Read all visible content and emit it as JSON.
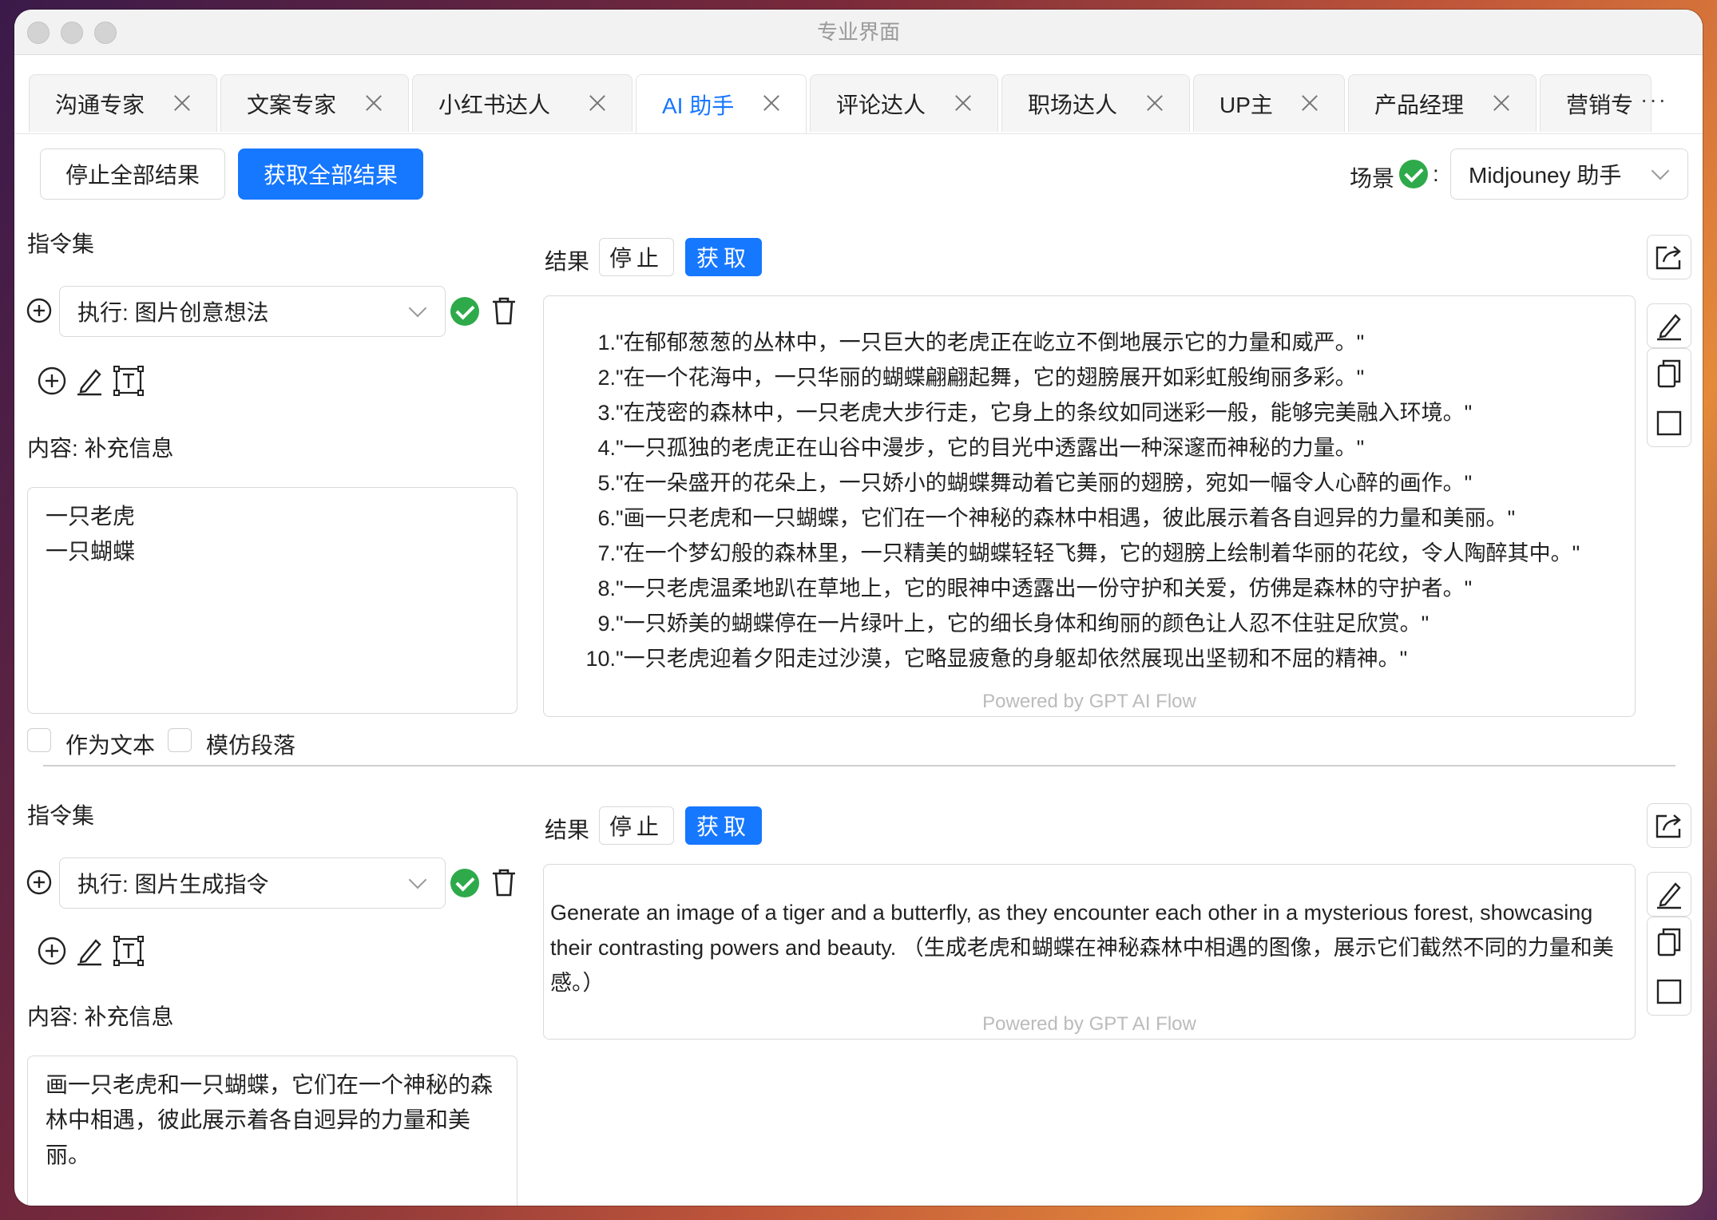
{
  "window": {
    "title": "专业界面"
  },
  "tabs": [
    {
      "label": "沟通专家"
    },
    {
      "label": "文案专家"
    },
    {
      "label": "小红书达人"
    },
    {
      "label": "AI 助手"
    },
    {
      "label": "评论达人"
    },
    {
      "label": "职场达人"
    },
    {
      "label": "UP主"
    },
    {
      "label": "产品经理"
    },
    {
      "label": "营销专"
    }
  ],
  "tab_more": "···",
  "toolbar": {
    "stop_all": "停止全部结果",
    "get_all": "获取全部结果",
    "scene_label": "场景",
    "scene_colon": ":",
    "scene_value": "Midjouney 助手"
  },
  "sections": [
    {
      "instruction_label": "指令集",
      "instruction_select": "执行: 图片创意想法",
      "content_label": "内容: 补充信息",
      "content_text": "一只老虎\n一只蝴蝶",
      "as_text_label": "作为文本",
      "imitate_label": "模仿段落",
      "result_label": "结果",
      "stop_label": "停止",
      "get_label": "获取",
      "result_items": [
        "\"在郁郁葱葱的丛林中，一只巨大的老虎正在屹立不倒地展示它的力量和威严。\"",
        "\"在一个花海中，一只华丽的蝴蝶翩翩起舞，它的翅膀展开如彩虹般绚丽多彩。\"",
        "\"在茂密的森林中，一只老虎大步行走，它身上的条纹如同迷彩一般，能够完美融入环境。\"",
        "\"一只孤独的老虎正在山谷中漫步，它的目光中透露出一种深邃而神秘的力量。\"",
        "\"在一朵盛开的花朵上，一只娇小的蝴蝶舞动着它美丽的翅膀，宛如一幅令人心醉的画作。\"",
        "\"画一只老虎和一只蝴蝶，它们在一个神秘的森林中相遇，彼此展示着各自迥异的力量和美丽。\"",
        "\"在一个梦幻般的森林里，一只精美的蝴蝶轻轻飞舞，它的翅膀上绘制着华丽的花纹，令人陶醉其中。\"",
        "\"一只老虎温柔地趴在草地上，它的眼神中透露出一份守护和关爱，仿佛是森林的守护者。\"",
        "\"一只娇美的蝴蝶停在一片绿叶上，它的细长身体和绚丽的颜色让人忍不住驻足欣赏。\"",
        "\"一只老虎迎着夕阳走过沙漠，它略显疲惫的身躯却依然展现出坚韧和不屈的精神。\""
      ],
      "powered": "Powered by GPT AI Flow"
    },
    {
      "instruction_label": "指令集",
      "instruction_select": "执行: 图片生成指令",
      "content_label": "内容: 补充信息",
      "content_text": "画一只老虎和一只蝴蝶，它们在一个神秘的森林中相遇，彼此展示着各自迥异的力量和美丽。",
      "result_label": "结果",
      "stop_label": "停止",
      "get_label": "获取",
      "result_text": "Generate an image of a tiger and a butterfly, as they encounter each other in a mysterious forest, showcasing their contrasting powers and beauty. （生成老虎和蝴蝶在神秘森林中相遇的图像，展示它们截然不同的力量和美感。）",
      "powered": "Powered by GPT AI Flow"
    }
  ],
  "colors": {
    "accent": "#1677ff",
    "success": "#2eaa4a"
  }
}
